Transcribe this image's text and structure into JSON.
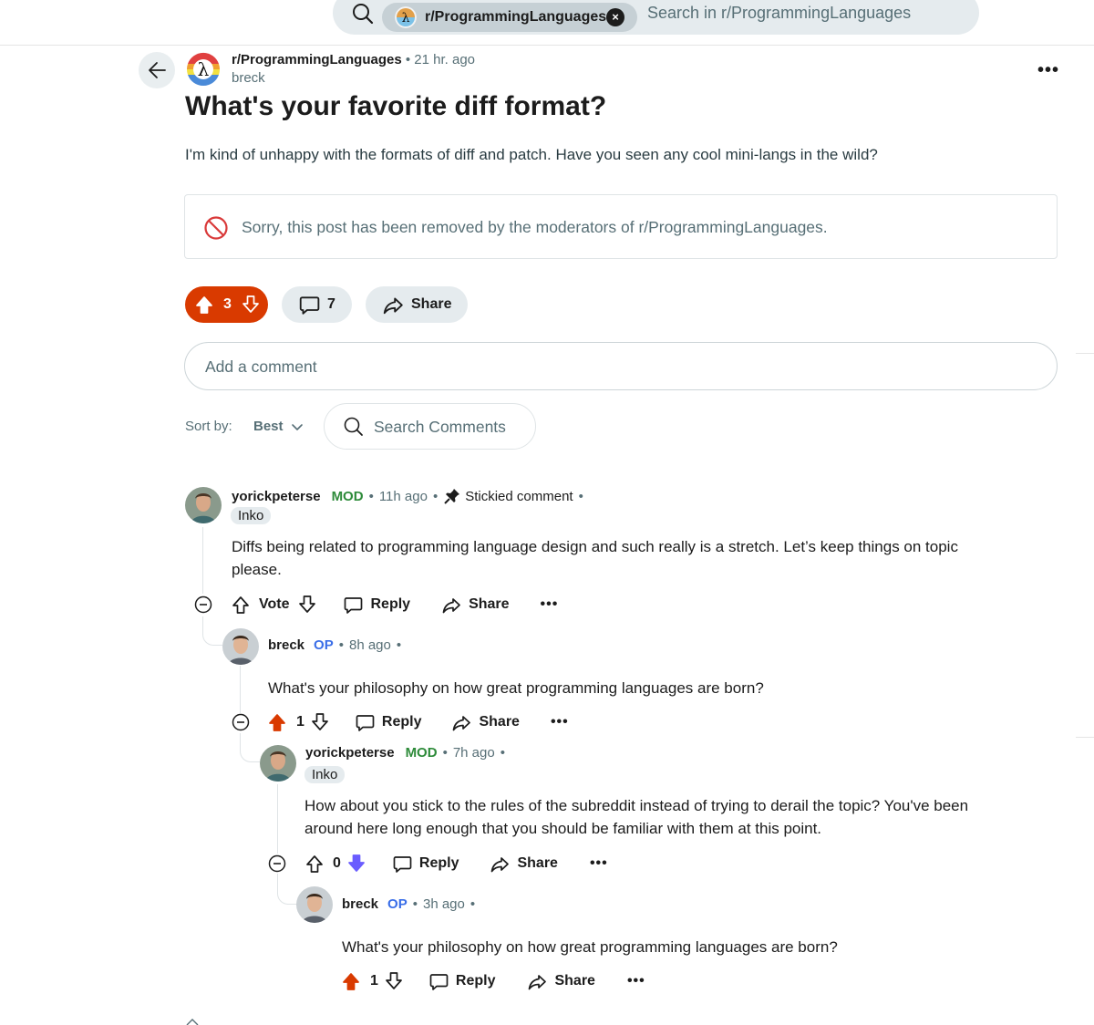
{
  "search": {
    "community_chip": "r/ProgrammingLanguages",
    "placeholder": "Search in r/ProgrammingLanguages"
  },
  "post": {
    "subreddit": "r/ProgrammingLanguages",
    "time": "21 hr. ago",
    "author": "breck",
    "title": "What's your favorite diff format?",
    "body": "I'm kind of unhappy with the formats of diff and patch. Have you seen any cool mini-langs in the wild?",
    "removed_notice": "Sorry, this post has been removed by the moderators of r/ProgrammingLanguages.",
    "votes": "3",
    "comments": "7",
    "share_label": "Share"
  },
  "add_comment_placeholder": "Add a comment",
  "sort": {
    "label": "Sort by:",
    "value": "Best"
  },
  "search_comments_placeholder": "Search Comments",
  "comments": [
    {
      "user": "yorickpeterse",
      "role": "MOD",
      "time": "11h ago",
      "sticky": "Stickied comment",
      "flair": "Inko",
      "body_1": "Diffs being related to programming language design and such really is a stretch. Let’s keep things on topic",
      "body_2": "please.",
      "vote_label": "Vote",
      "reply_label": "Reply",
      "share_label": "Share"
    },
    {
      "user": "breck",
      "role": "OP",
      "time": "8h ago",
      "body_1": "What's your philosophy on how great programming languages are born?",
      "votes": "1",
      "reply_label": "Reply",
      "share_label": "Share"
    },
    {
      "user": "yorickpeterse",
      "role": "MOD",
      "time": "7h ago",
      "flair": "Inko",
      "body_1": "How about you stick to the rules of the subreddit instead of trying to derail the topic? You've been",
      "body_2": "around here long enough that you should be familiar with them at this point.",
      "votes": "0",
      "reply_label": "Reply",
      "share_label": "Share"
    },
    {
      "user": "breck",
      "role": "OP",
      "time": "3h ago",
      "body_1": "What's your philosophy on how great programming languages are born?",
      "votes": "1",
      "reply_label": "Reply",
      "share_label": "Share"
    }
  ],
  "colors": {
    "upvote_active": "#d93a00",
    "downvote_active": "#6a5cff",
    "mod_green": "#2e8b3a",
    "op_blue": "#3a6ee8",
    "removed_red": "#d93a3a"
  }
}
